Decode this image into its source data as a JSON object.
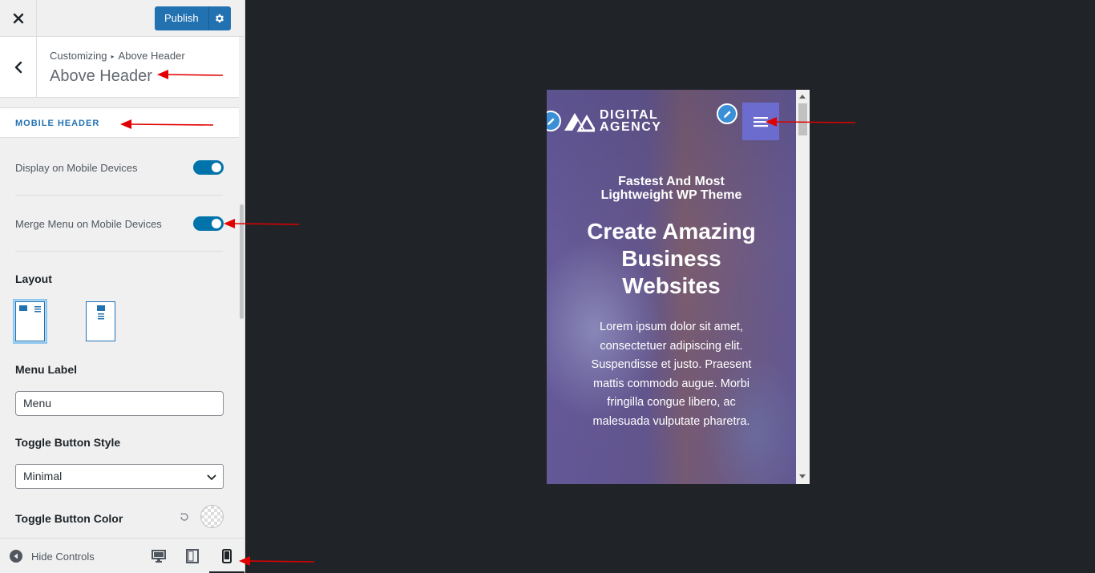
{
  "topbar": {
    "close_icon": "close-icon",
    "publish_label": "Publish",
    "settings_icon": "gear-icon"
  },
  "section": {
    "breadcrumb_root": "Customizing",
    "breadcrumb_current": "Above Header",
    "title": "Above Header"
  },
  "group": {
    "title": "MOBILE HEADER"
  },
  "controls": {
    "display_mobile": {
      "label": "Display on Mobile Devices",
      "enabled": true
    },
    "merge_menu": {
      "label": "Merge Menu on Mobile Devices",
      "enabled": true
    },
    "layout": {
      "label": "Layout",
      "selected": "layout-1"
    },
    "menu_label": {
      "label": "Menu Label",
      "value": "Menu"
    },
    "toggle_style": {
      "label": "Toggle Button Style",
      "value": "Minimal"
    },
    "toggle_color": {
      "label": "Toggle Button Color"
    }
  },
  "footer": {
    "hide_controls": "Hide Controls",
    "devices": [
      "desktop",
      "tablet",
      "mobile"
    ],
    "active_device": "mobile"
  },
  "preview": {
    "logo_line1": "DIGITAL",
    "logo_line2": "AGENCY",
    "tagline_line1": "Fastest And Most",
    "tagline_line2": "Lightweight WP Theme",
    "headline_line1": "Create Amazing",
    "headline_line2": "Business",
    "headline_line3": "Websites",
    "body_lines": [
      "Lorem ipsum dolor sit amet,",
      "consectetuer adipiscing elit.",
      "Suspendisse et justo. Praesent",
      "mattis commodo augue. Morbi",
      "fringilla congue libero, ac",
      "malesuada vulputate pharetra."
    ]
  },
  "colors": {
    "accent": "#2271b1",
    "toggle_on": "#0073aa",
    "menu_button": "#6c6ccf",
    "annotation_arrow": "#e00000"
  }
}
